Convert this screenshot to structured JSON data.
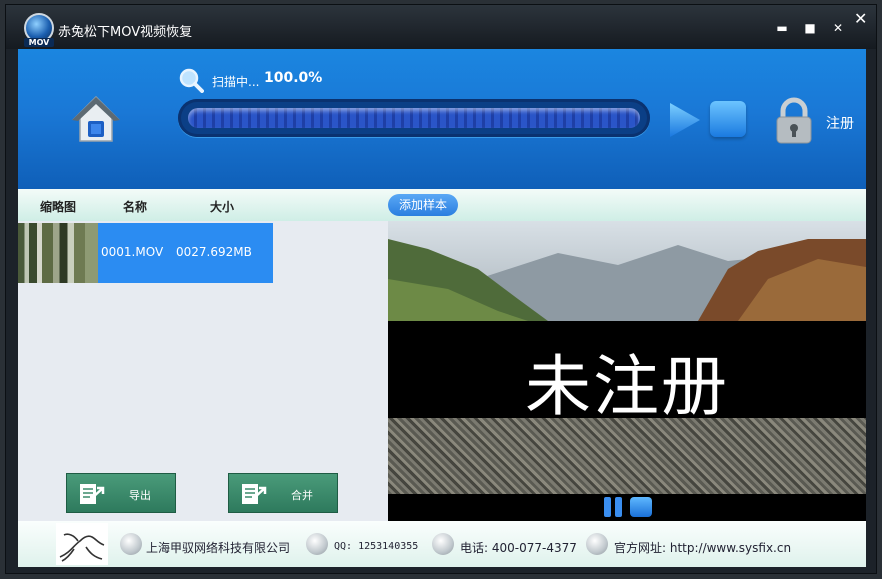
{
  "window": {
    "title": "赤兔松下MOV视频恢复",
    "logo_text": "MOV",
    "minimize": "▬",
    "maximize": "■",
    "close_small": "✕",
    "close": "✕"
  },
  "header": {
    "scan_label": "扫描中...",
    "scan_percent": "100.0%",
    "progress": 1.0,
    "register_label": "注册"
  },
  "list": {
    "columns": [
      "缩略图",
      "名称",
      "大小"
    ],
    "rows": [
      {
        "name": "0001.MOV",
        "size": "0027.692MB"
      }
    ]
  },
  "actions": {
    "export_label": "导出",
    "merge_label": "合并"
  },
  "preview": {
    "add_sample_label": "添加样本",
    "watermark": "未注册"
  },
  "footer": {
    "company": "上海甲驭网络科技有限公司",
    "qq": "QQ: 1253140355",
    "phone": "电话: 400-077-4377",
    "website": "官方网址: http://www.sysfix.cn"
  },
  "colors": {
    "header_blue": "#1a78d6",
    "selection_blue": "#2b8cf2",
    "button_green": "#3a8a6a"
  }
}
